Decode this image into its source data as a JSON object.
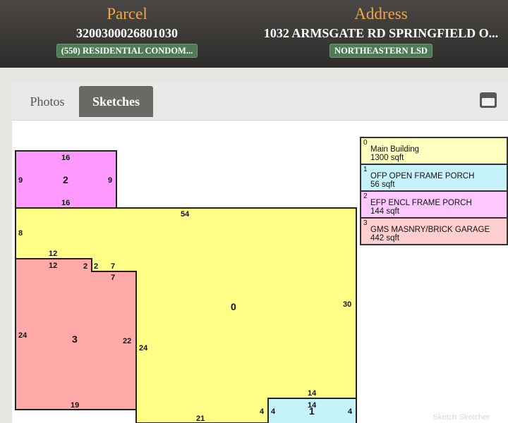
{
  "header": {
    "parcel": {
      "title": "Parcel",
      "number": "3200300026801030",
      "class_badge": "(550) RESIDENTIAL CONDOM..."
    },
    "address": {
      "title": "Address",
      "value": "1032 ARMSGATE RD SPRINGFIELD O...",
      "district_badge": "NORTHEASTERN LSD"
    }
  },
  "tabs": [
    {
      "label": "Photos",
      "active": false
    },
    {
      "label": "Sketches",
      "active": true
    }
  ],
  "collapse_icon": "window-minimize-icon",
  "colors": {
    "area0": "#ffff88",
    "area1": "#c6f2fa",
    "area2": "#ff99ff",
    "area3": "#ffaaa8",
    "legend0": "#ffffc0",
    "legend1": "#c6f2fa",
    "legend2": "#ffc7ff",
    "legend3": "#ffcfcf"
  },
  "legend": [
    {
      "num": "0",
      "name": "Main Building",
      "area": "1300 sqft"
    },
    {
      "num": "1",
      "name": "OFP OPEN FRAME PORCH",
      "area": "56 sqft"
    },
    {
      "num": "2",
      "name": "EFP ENCL FRAME PORCH",
      "area": "144 sqft"
    },
    {
      "num": "3",
      "name": "GMS MASNRY/BRICK GARAGE",
      "area": "442 sqft"
    }
  ],
  "sketch": {
    "area2": {
      "id": "2",
      "top": "16",
      "left": "9",
      "right": "9",
      "bottom": "16"
    },
    "area0": {
      "id": "0",
      "top": "54",
      "left": "8",
      "right": "30",
      "step_top": "12",
      "step_mid_a": "2",
      "step_mid_b": "7",
      "inner_right": "24",
      "bottom": "21",
      "porch_left": "4",
      "porch_top": "14"
    },
    "area3": {
      "id": "3",
      "top": "12",
      "notch_a": "2",
      "notch_b": "7",
      "left": "24",
      "right": "22",
      "bottom": "19"
    },
    "area1": {
      "id": "1",
      "top": "14",
      "left": "4",
      "right": "4"
    }
  },
  "watermark": "Sketch Sketcher"
}
